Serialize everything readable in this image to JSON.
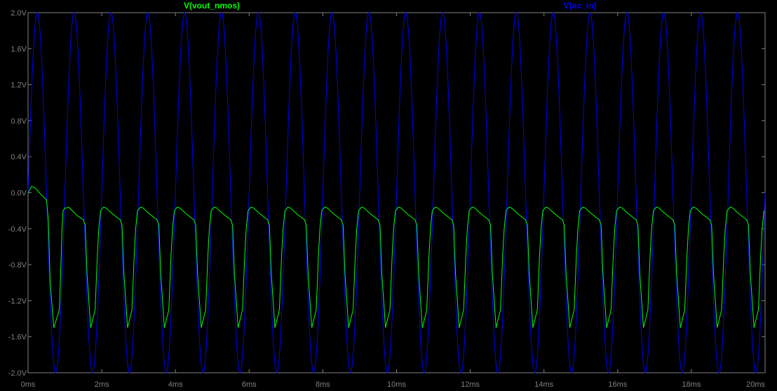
{
  "chart_data": {
    "type": "line",
    "title": "",
    "xlabel": "",
    "ylabel": "",
    "xlim": [
      0,
      20
    ],
    "ylim": [
      -2.0,
      2.0
    ],
    "x_unit": "ms",
    "y_unit": "V",
    "x_ticks": [
      "0ms",
      "2ms",
      "4ms",
      "6ms",
      "8ms",
      "10ms",
      "12ms",
      "14ms",
      "16ms",
      "18ms",
      "20ms"
    ],
    "y_ticks": [
      "2.0V",
      "1.6V",
      "1.2V",
      "0.8V",
      "0.4V",
      "0.0V",
      "-0.4V",
      "-0.8V",
      "-1.2V",
      "-1.6V",
      "-2.0V"
    ],
    "grid": false,
    "legend_placement": "top",
    "background": "#000000",
    "axis_color": "#808080",
    "series": [
      {
        "name": "V(ac_in)",
        "color": "#0000ff",
        "shape": "sine",
        "amplitude_v": 2.0,
        "offset_v": 0.0,
        "frequency_hz": 1000,
        "cycles_shown": 20,
        "peak_times_ms": [
          0.25,
          1.25,
          2.25,
          3.25,
          4.25,
          5.25,
          6.25,
          7.25,
          8.25,
          9.25,
          10.25,
          11.25,
          12.25,
          13.25,
          14.25,
          15.25,
          16.25,
          17.25,
          18.25,
          19.25
        ],
        "trough_times_ms": [
          0.75,
          1.75,
          2.75,
          3.75,
          4.75,
          5.75,
          6.75,
          7.75,
          8.75,
          9.75,
          10.75,
          11.75,
          12.75,
          13.75,
          14.75,
          15.75,
          16.75,
          17.75,
          18.75,
          19.75
        ]
      },
      {
        "name": "V(vout_nmos)",
        "color": "#00ff00",
        "period_ms": 1.0,
        "x": [
          0.0,
          0.1,
          0.2,
          0.35,
          0.5,
          0.55,
          0.6,
          0.7,
          0.85,
          0.9,
          0.92,
          0.95,
          1.0,
          1.05,
          1.1,
          1.2,
          1.35,
          1.5
        ],
        "y": [
          0.0,
          0.07,
          0.05,
          -0.02,
          -0.08,
          -0.3,
          -1.0,
          -1.5,
          -1.3,
          -0.7,
          -0.4,
          -0.2,
          -0.17,
          -0.17,
          -0.16,
          -0.2,
          -0.26,
          -0.3
        ],
        "typical_cycle": {
          "peak_v": -0.16,
          "min_v": -1.55,
          "peak_phase_ms": 0.05
        }
      }
    ]
  }
}
